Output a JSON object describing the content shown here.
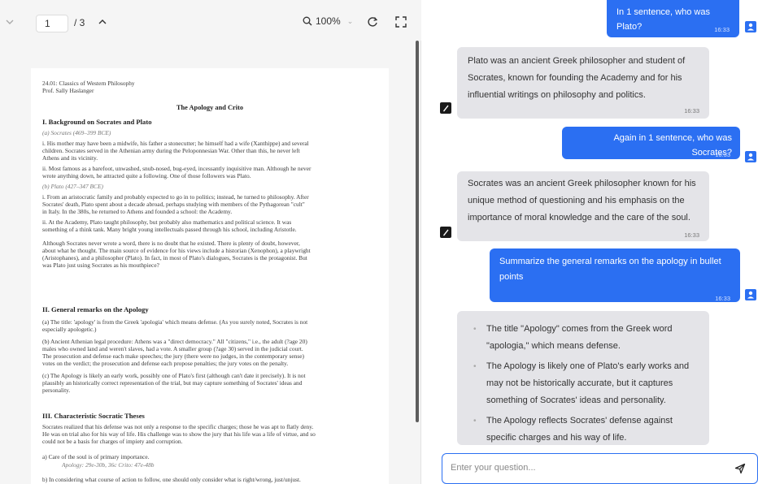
{
  "pdf_viewer": {
    "page_current": "1",
    "page_total": "/ 3",
    "zoom": "100%",
    "document": {
      "course": "24.01: Classics of Western Philosophy",
      "professor": "Prof. Sally Haslanger",
      "title": "The Apology and Crito",
      "lines": [
        "I.  Background on Socrates and Plato",
        "(a) Socrates (469–399 BCE)",
        "i. His mother may have been a midwife, his father a stonecutter; he himself had a wife (Xanthippe) and several",
        "children. Socrates served in the Athenian army during the Peloponnesian War. Other than this, he never left",
        "Athens and its vicinity.",
        "ii. Most famous as a barefoot, unwashed, snub-nosed, bug-eyed, incessantly inquisitive man. Although he never",
        "wrote anything down, he attracted quite a following. One of those followers was Plato.",
        "(b) Plato (427–347 BCE)",
        "i. From an aristocratic family and probably expected to go in to politics; instead, he turned to philosophy. After",
        "Socrates' death, Plato spent about a decade abroad, perhaps studying with members of the Pythagorean \"cult\"",
        "in Italy. In the 380s, he returned to Athens and founded a school: the Academy.",
        "ii. At the Academy, Plato taught philosophy, but probably also mathematics and political science. It was",
        "something of a think tank. Many bright young intellectuals passed through his school, including Aristotle.",
        "Although Socrates never wrote a word, there is no doubt that he existed.  There is plenty of doubt, however,",
        "about what he thought.  The main source of evidence for his views include a historian (Xenophon), a playwright",
        "(Aristophanes), and a philosopher (Plato). In fact, in most of Plato's dialogues, Socrates is the protagonist.  But",
        "was Plato just using Socrates as his mouthpiece?",
        "II.  General remarks on the Apology",
        "(a) The title: 'apology' is from the Greek 'apologia' which means defense. (As you surely noted, Socrates is not",
        "especially apologetic.)",
        "(b) Ancient Athenian legal procedure:  Athens was a \"direct democracy.\"  All \"citizens,\" i.e., the adult (?age 20)",
        "males who owned land and weren't slaves, had a vote.  A smaller group (?age 30) served in the judicial court.",
        "The prosecution and defense each make speeches; the jury (there were no judges, in the contemporary sense)",
        "votes on the verdict; the prosecution and defense each propose penalties; the jury votes on the penalty.",
        "(c) The Apology is likely an early work, possibly one of Plato's first (although can't date it precisely).  It is not",
        "plausibly an historically correct representation of the trial, but may capture something of Socrates' ideas and",
        "personality.",
        "III. Characteristic Socratic Theses",
        "Socrates realized that his defense was not only a response to the specific charges; those he was apt to flatly deny.",
        "He was on trial also for his way of life.  His challenge was to show the jury that his life was a life of virtue, and so",
        "could not be a basis for charges of impiety and corruption.",
        "a)  Care of the soul is of primary importance.",
        "Apology: 29e-30b, 36c     Crito: 47e-48b",
        "b)  In considering what course of action to follow, one should only consider what is right/wrong, just/unjust."
      ]
    }
  },
  "chat": {
    "messages": [
      {
        "role": "user",
        "text": "In 1 sentence, who was Plato?",
        "time": "16:33"
      },
      {
        "role": "assistant",
        "text": "Plato was an ancient Greek philosopher and student of Socrates, known for founding the Academy and for his influential writings on philosophy and politics.",
        "time": "16:33"
      },
      {
        "role": "user",
        "text": "Again in 1 sentence, who was Socrates?",
        "time": "16:33"
      },
      {
        "role": "assistant",
        "text": "Socrates was an ancient Greek philosopher known for his unique method of questioning and his emphasis on the importance of moral knowledge and the care of the soul.",
        "time": "16:33"
      },
      {
        "role": "user",
        "text": "Summarize the general remarks on the apology in bullet points",
        "time": "16:33"
      },
      {
        "role": "assistant",
        "bullets": [
          "The title \"Apology\" comes from the Greek word \"apologia,\" which means defense.",
          "The Apology is likely one of Plato's early works and may not be historically accurate, but it captures something of Socrates' ideas and personality.",
          "The Apology reflects Socrates' defense against specific charges and his way of life."
        ]
      }
    ],
    "input_placeholder": "Enter your question...",
    "accent_color": "#2b6ff2"
  }
}
